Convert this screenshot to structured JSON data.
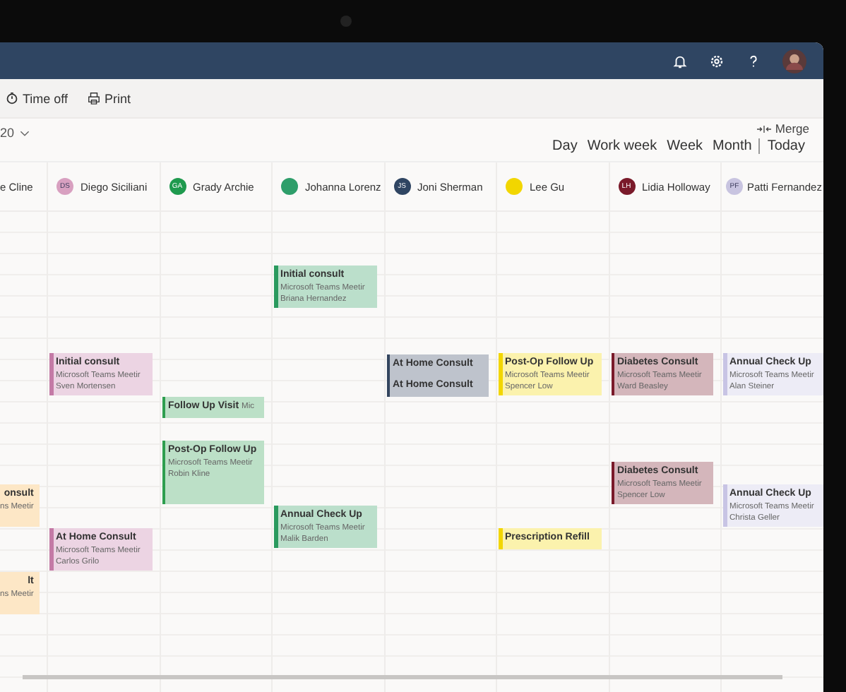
{
  "toolbar": {
    "items": [
      "Time off",
      "Print"
    ]
  },
  "date_picker": {
    "label": "20"
  },
  "merge": {
    "label": "Merge"
  },
  "views": [
    "Day",
    "Work week",
    "Week",
    "Month"
  ],
  "today": {
    "label": "Today"
  },
  "columns": [
    {
      "name": "e Cline",
      "events": [
        {
          "title": "onsult",
          "subtitle": "ns Meetir",
          "color": "#fde7c6"
        },
        {
          "title": "lt",
          "subtitle": "ns Meetir",
          "color": "#fde7c6"
        }
      ]
    },
    {
      "name": "Diego Siciliani",
      "initials": "DS",
      "color": "#d8a0c0",
      "events": [
        {
          "title": "Initial consult",
          "subtitle": "Microsoft Teams Meetir",
          "person": "Sven Mortensen",
          "color": "#c47aa6"
        },
        {
          "title": "At Home Consult",
          "subtitle": "Microsoft Teams Meetir",
          "person": "Carlos Grilo",
          "color": "#c47aa6"
        }
      ]
    },
    {
      "name": "Grady Archie",
      "initials": "GA",
      "color": "#1f9a4e",
      "events": [
        {
          "title": "Follow Up Visit",
          "subtitle": "Mic",
          "kind": "inline",
          "color": "#2e9e4f"
        },
        {
          "title": "Post-Op Follow Up",
          "subtitle": "Microsoft Teams Meetir",
          "person": "Robin Kline",
          "color": "#2e9e4f"
        }
      ]
    },
    {
      "name": "Johanna Lorenz",
      "color": "#2e9e6a",
      "events": [
        {
          "title": "Initial consult",
          "subtitle": "Microsoft Teams Meetir",
          "person": "Briana Hernandez",
          "color": "#2a9a5e"
        },
        {
          "title": "Annual Check Up",
          "subtitle": "Microsoft Teams Meetir",
          "person": "Malik Barden",
          "color": "#2a9a5e"
        }
      ]
    },
    {
      "name": "Joni Sherman",
      "initials": "JS",
      "color": "#2f4562",
      "events": [
        {
          "title": "At Home Consult",
          "color": "#34455f"
        },
        {
          "title": "At Home Consult",
          "color": "#34455f"
        }
      ]
    },
    {
      "name": "Lee Gu",
      "color": "#f2d600",
      "events": [
        {
          "title": "Post-Op Follow Up",
          "subtitle": "Microsoft Teams Meetir",
          "person": "Spencer Low",
          "color": "#f2d600"
        },
        {
          "title": "Prescription Refill",
          "color": "#f2d600"
        }
      ]
    },
    {
      "name": "Lidia Holloway",
      "initials": "LH",
      "color": "#7a1a2a",
      "events": [
        {
          "title": "Diabetes Consult",
          "subtitle": "Microsoft Teams Meetir",
          "person": "Ward Beasley",
          "color": "#7a1a2a"
        },
        {
          "title": "Diabetes Consult",
          "subtitle": "Microsoft Teams Meetir",
          "person": "Spencer Low",
          "color": "#7a1a2a"
        }
      ]
    },
    {
      "name": "Patti Fernandez",
      "initials": "PF",
      "color": "#c8c4e0",
      "events": [
        {
          "title": "Annual Check Up",
          "subtitle": "Microsoft Teams Meetir",
          "person": "Alan Steiner",
          "color": "#c8c4e4"
        },
        {
          "title": "Annual Check Up",
          "subtitle": "Microsoft Teams Meetir",
          "person": "Christa Geller",
          "color": "#c8c4e4"
        }
      ]
    }
  ]
}
